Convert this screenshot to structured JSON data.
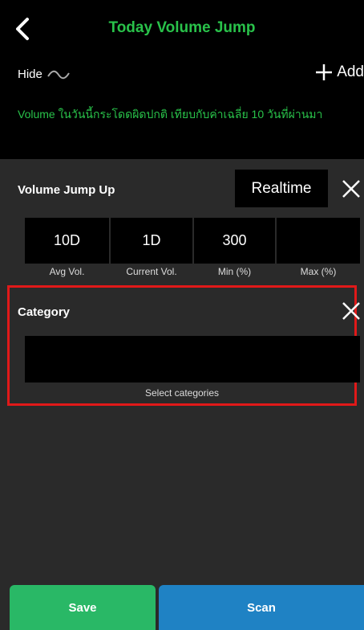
{
  "header": {
    "title": "Today Volume Jump",
    "hide_label": "Hide",
    "add_label": "Add",
    "description": "Volume ในวันนี้กระโดดผิดปกติ เทียบกับค่าเฉลี่ย 10 วันที่ผ่านมา"
  },
  "volume_jump": {
    "title": "Volume Jump Up",
    "mode_label": "Realtime",
    "cells": [
      {
        "value": "10D",
        "label": "Avg Vol."
      },
      {
        "value": "1D",
        "label": "Current Vol."
      },
      {
        "value": "300",
        "label": "Min (%)"
      },
      {
        "value": "",
        "label": "Max (%)"
      }
    ]
  },
  "category": {
    "title": "Category",
    "hint": "Select categories"
  },
  "footer": {
    "save_label": "Save",
    "scan_label": "Scan"
  },
  "colors": {
    "accent_green": "#29c24a",
    "save_green": "#29b866",
    "scan_blue": "#1f82c4",
    "highlight_red": "#e01919"
  }
}
